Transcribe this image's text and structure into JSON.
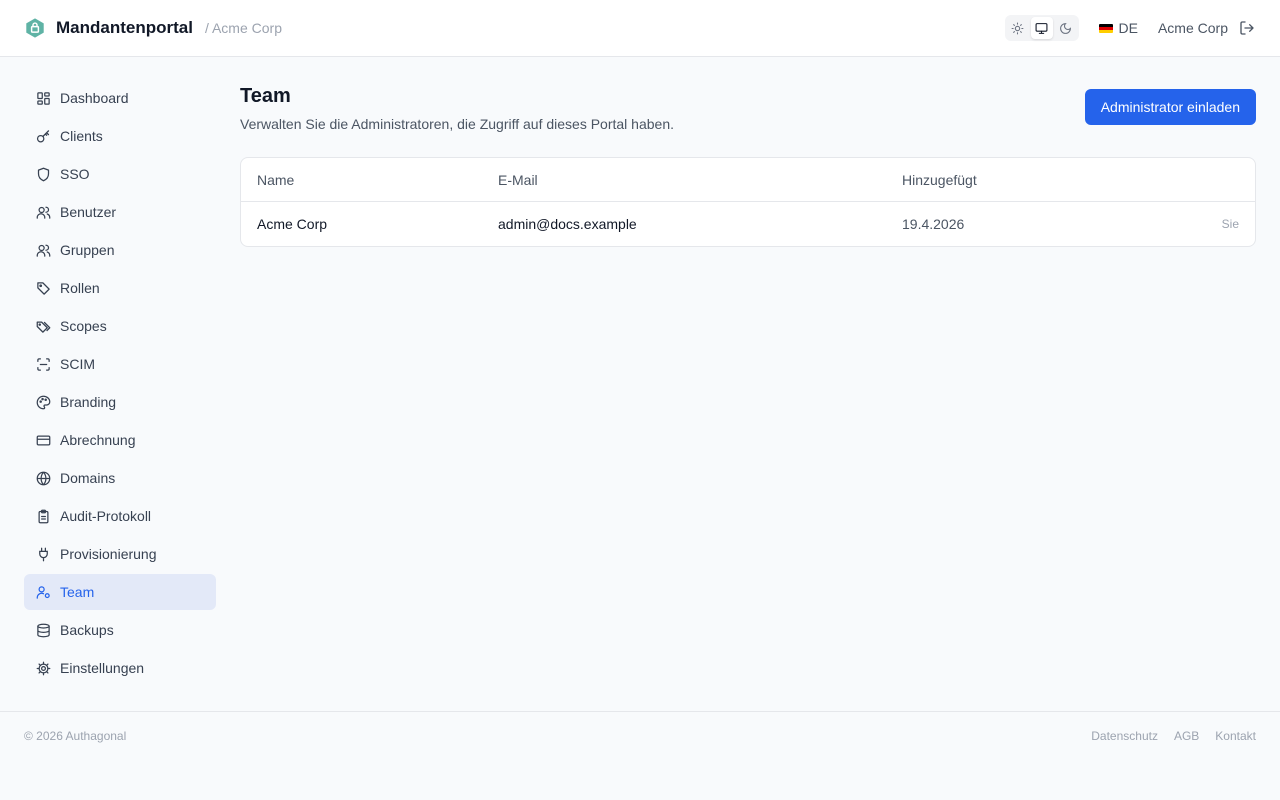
{
  "header": {
    "title": "Mandantenportal",
    "breadcrumb": "/ Acme Corp",
    "theme_options": [
      "light",
      "system",
      "dark"
    ],
    "theme_selected": "system",
    "language": "DE",
    "tenant": "Acme Corp"
  },
  "colors": {
    "accent": "#2563eb",
    "logo": "#5fb3a5",
    "active_nav_bg": "#e3e9f8"
  },
  "sidebar": {
    "items": [
      {
        "label": "Dashboard",
        "icon": "dashboard-icon"
      },
      {
        "label": "Clients",
        "icon": "key-icon"
      },
      {
        "label": "SSO",
        "icon": "shield-icon"
      },
      {
        "label": "Benutzer",
        "icon": "users-icon"
      },
      {
        "label": "Gruppen",
        "icon": "users-icon"
      },
      {
        "label": "Rollen",
        "icon": "tag-icon"
      },
      {
        "label": "Scopes",
        "icon": "tags-icon"
      },
      {
        "label": "SCIM",
        "icon": "scan-icon"
      },
      {
        "label": "Branding",
        "icon": "palette-icon"
      },
      {
        "label": "Abrechnung",
        "icon": "credit-card-icon"
      },
      {
        "label": "Domains",
        "icon": "globe-icon"
      },
      {
        "label": "Audit-Protokoll",
        "icon": "clipboard-icon"
      },
      {
        "label": "Provisionierung",
        "icon": "plug-icon"
      },
      {
        "label": "Team",
        "icon": "user-cog-icon",
        "active": true
      },
      {
        "label": "Backups",
        "icon": "database-icon"
      },
      {
        "label": "Einstellungen",
        "icon": "gear-icon"
      }
    ]
  },
  "main": {
    "title": "Team",
    "subtitle": "Verwalten Sie die Administratoren, die Zugriff auf dieses Portal haben.",
    "invite_label": "Administrator einladen",
    "table": {
      "columns": [
        "Name",
        "E-Mail",
        "Hinzugefügt"
      ],
      "rows": [
        {
          "name": "Acme Corp",
          "email": "admin@docs.example",
          "added": "19.4.2026",
          "tag": "Sie"
        }
      ]
    }
  },
  "footer": {
    "copyright": "© 2026 Authagonal",
    "links": [
      "Datenschutz",
      "AGB",
      "Kontakt"
    ]
  }
}
